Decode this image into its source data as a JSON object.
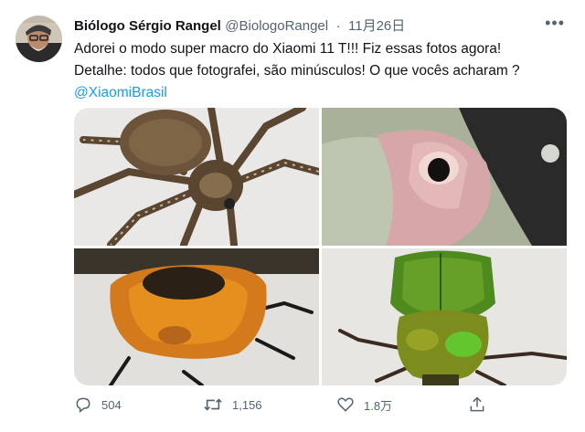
{
  "tweet": {
    "author_name": "Biólogo Sérgio Rangel",
    "author_handle": "@BiologoRangel",
    "separator": "·",
    "date": "11月26日",
    "text_lines": [
      "Adorei o modo super macro do Xiaomi 11 T!!! Fiz essas fotos agora!",
      "Detalhe: todos que fotografei, são minúsculos! O que vocês acharam ?"
    ],
    "mention": "@XiaomiBrasil",
    "media": [
      "spider-photo",
      "wood-hole-photo",
      "orange-beetle-photo",
      "green-beetle-photo"
    ]
  },
  "actions": {
    "reply_count": "504",
    "retweet_count": "1,156",
    "like_count": "1.8万",
    "share_count": ""
  },
  "colors": {
    "text": "#0f1419",
    "secondary": "#536471",
    "link": "#1d9bf0"
  },
  "icons": [
    "more-icon",
    "reply-icon",
    "retweet-icon",
    "like-icon",
    "share-icon"
  ]
}
